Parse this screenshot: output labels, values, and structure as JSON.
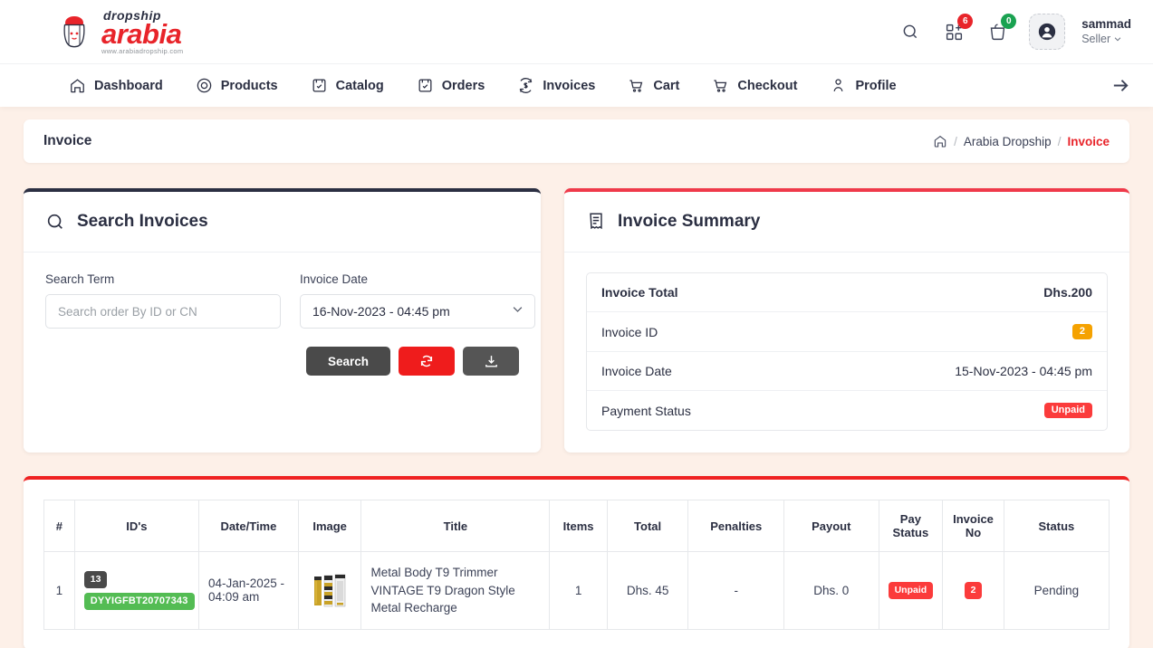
{
  "brand": {
    "logo_top": "dropship",
    "logo_main": "arabia",
    "logo_sub": "www.arabiadropship.com"
  },
  "header": {
    "icons": [
      {
        "name": "search-icon",
        "badge": null
      },
      {
        "name": "add-product-icon",
        "badge": "6",
        "badge_color": "#e8242a"
      },
      {
        "name": "cart-icon",
        "badge": "0",
        "badge_color": "#1aa251"
      }
    ],
    "user": {
      "name": "sammad",
      "role": "Seller"
    }
  },
  "nav": {
    "items": [
      {
        "label": "Dashboard",
        "icon": "home-icon"
      },
      {
        "label": "Products",
        "icon": "circle-target-icon"
      },
      {
        "label": "Catalog",
        "icon": "box-check-icon"
      },
      {
        "label": "Orders",
        "icon": "box-check-icon"
      },
      {
        "label": "Invoices",
        "icon": "refresh-dollar-icon"
      },
      {
        "label": "Cart",
        "icon": "cart-icon"
      },
      {
        "label": "Checkout",
        "icon": "cart-icon"
      },
      {
        "label": "Profile",
        "icon": "users-icon"
      }
    ],
    "overflow_icon": "arrow-right-icon"
  },
  "breadcrumb": {
    "page_title": "Invoice",
    "home_icon": "home-icon",
    "items": [
      "Arabia Dropship",
      "Invoice"
    ],
    "separator": "/"
  },
  "search_card": {
    "title": "Search Invoices",
    "icon": "search-icon",
    "search_term_label": "Search Term",
    "search_term_placeholder": "Search order By ID or CN",
    "search_term_value": "",
    "invoice_date_label": "Invoice Date",
    "invoice_date_value": "16-Nov-2023 - 04:45 pm",
    "search_button": "Search",
    "refresh_icon": "refresh-icon",
    "download_icon": "download-icon",
    "accent_border": "#2b2f42"
  },
  "summary_card": {
    "title": "Invoice Summary",
    "icon": "receipt-icon",
    "accent_border": "#ef3a4a",
    "rows": [
      {
        "label": "Invoice Total",
        "value": "Dhs.200",
        "type": "text",
        "bold": true
      },
      {
        "label": "Invoice ID",
        "value": "2",
        "type": "pill-orange"
      },
      {
        "label": "Invoice Date",
        "value": "15-Nov-2023 - 04:45 pm",
        "type": "text"
      },
      {
        "label": "Payment Status",
        "value": "Unpaid",
        "type": "pill-red"
      }
    ]
  },
  "table_card": {
    "accent_border": "#ef2222",
    "columns": [
      "#",
      "ID's",
      "Date/Time",
      "Image",
      "Title",
      "Items",
      "Total",
      "Penalties",
      "Payout",
      "Pay Status",
      "Invoice No",
      "Status"
    ],
    "rows": [
      {
        "index": "1",
        "id_badge": "13",
        "cn_badge": "DYYIGFBT20707343",
        "datetime": "04-Jan-2025 - 04:09 am",
        "image_alt": "Metal Body T9 Trimmer product thumbnail",
        "title": "Metal Body T9 Trimmer VINTAGE T9 Dragon Style Metal Recharge",
        "items": "1",
        "total": "Dhs. 45",
        "penalties": "-",
        "payout": "Dhs. 0",
        "pay_status": "Unpaid",
        "invoice_no": "2",
        "status": "Pending"
      }
    ]
  },
  "colors": {
    "page_bg": "#fdf0e8",
    "brand_red": "#e8242a",
    "dark": "#2b2f42",
    "green": "#53bc53",
    "orange": "#f5a201"
  }
}
